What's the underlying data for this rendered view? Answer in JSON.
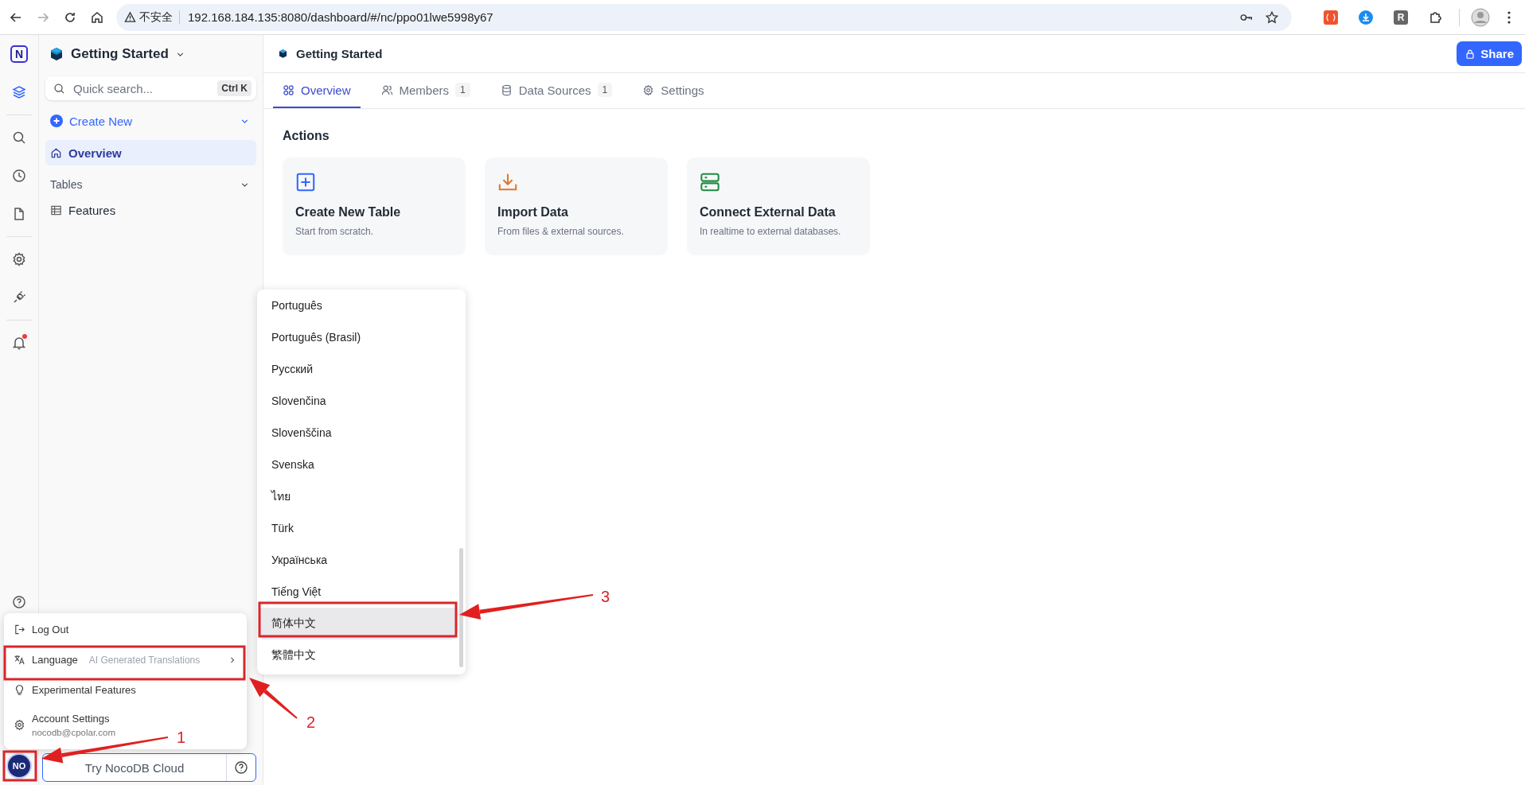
{
  "browser": {
    "security_label": "不安全",
    "url": "192.168.184.135:8080/dashboard/#/nc/ppo01lwe5998y67",
    "extension_letter": "R"
  },
  "rail": {
    "logo": "N",
    "items": [
      {
        "kind": "layers",
        "selected": true,
        "unread": false
      },
      {
        "kind": "search",
        "selected": false,
        "unread": false
      },
      {
        "kind": "clock",
        "selected": false,
        "unread": false
      },
      {
        "kind": "file",
        "selected": false,
        "unread": false
      },
      {
        "kind": "gear",
        "selected": false,
        "unread": false
      },
      {
        "kind": "plug",
        "selected": false,
        "unread": false
      },
      {
        "kind": "bell",
        "selected": false,
        "unread": true
      },
      {
        "kind": "help",
        "selected": false,
        "unread": false
      }
    ]
  },
  "sidebar": {
    "base": "Getting Started",
    "search": {
      "placeholder": "Quick search...",
      "shortcut": "Ctrl K"
    },
    "create_new": "Create New",
    "items": [
      {
        "label": "Overview",
        "selected": true
      }
    ],
    "tables_heading": "Tables",
    "tables": [
      {
        "label": "Features"
      }
    ]
  },
  "main": {
    "title": "Getting Started",
    "share": "Share",
    "tabs": [
      {
        "kind": "overview",
        "label": "Overview",
        "selected": true
      },
      {
        "kind": "members",
        "label": "Members",
        "count": "1",
        "selected": false
      },
      {
        "kind": "sources",
        "label": "Data Sources",
        "count": "1",
        "selected": false
      },
      {
        "kind": "settings",
        "label": "Settings",
        "selected": false
      }
    ],
    "actions_heading": "Actions",
    "cards": [
      {
        "kind": "create",
        "title": "Create New Table",
        "subtitle": "Start from scratch."
      },
      {
        "kind": "import",
        "title": "Import Data",
        "subtitle": "From files & external sources."
      },
      {
        "kind": "connect",
        "title": "Connect External Data",
        "subtitle": "In realtime to external databases."
      }
    ]
  },
  "user_menu": {
    "items": [
      {
        "kind": "logout",
        "label": "Log Out"
      },
      {
        "kind": "language",
        "label": "Language",
        "hint": "AI Generated Translations"
      },
      {
        "kind": "experimental",
        "label": "Experimental Features"
      },
      {
        "kind": "account",
        "label": "Account Settings",
        "email": "nocodb@cpolar.com"
      }
    ]
  },
  "language_menu": {
    "items": [
      {
        "label": "Português",
        "selected": false
      },
      {
        "label": "Português (Brasil)",
        "selected": false
      },
      {
        "label": "Русский",
        "selected": false
      },
      {
        "label": "Slovenčina",
        "selected": false
      },
      {
        "label": "Slovenščina",
        "selected": false
      },
      {
        "label": "Svenska",
        "selected": false
      },
      {
        "label": "ไทย",
        "selected": false
      },
      {
        "label": "Türk",
        "selected": false
      },
      {
        "label": "Українська",
        "selected": false
      },
      {
        "label": "Tiếng Việt",
        "selected": false
      },
      {
        "label": "简体中文",
        "selected": true
      },
      {
        "label": "繁體中文",
        "selected": false
      }
    ]
  },
  "footer": {
    "avatar": "NO",
    "cloud_button": "Try NocoDB Cloud"
  },
  "annotations": [
    {
      "label": "1"
    },
    {
      "label": "2"
    },
    {
      "label": "3"
    }
  ]
}
